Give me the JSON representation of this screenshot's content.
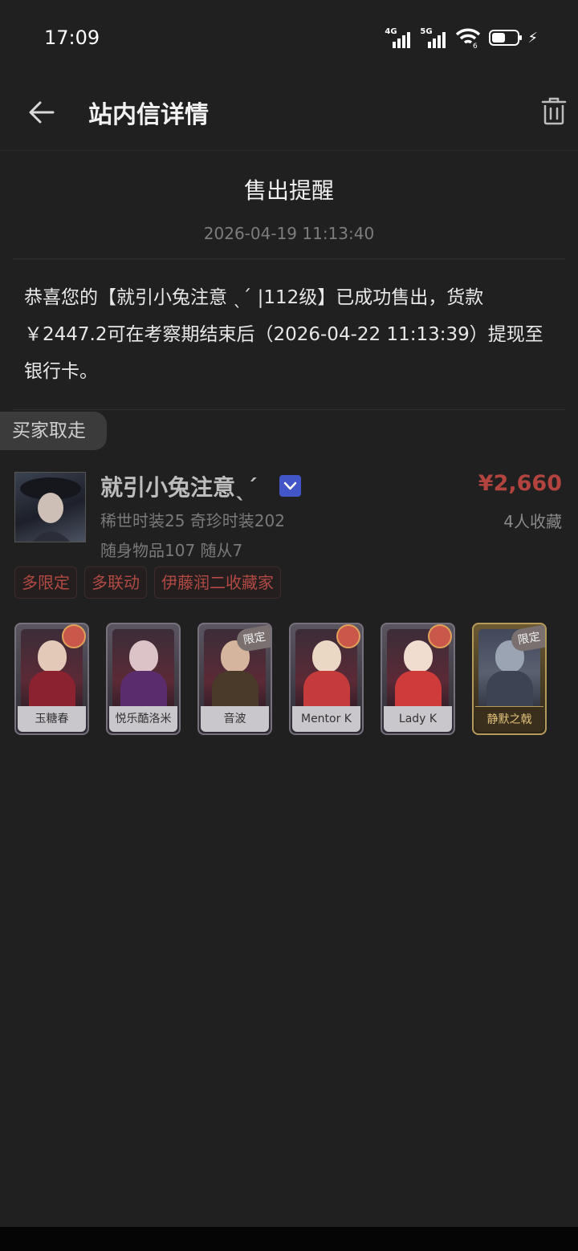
{
  "status_bar": {
    "time": "17:09",
    "signal1_tag": "4G",
    "signal2_tag": "5G",
    "wifi_badge": "6",
    "icons": [
      "signal-4g-icon",
      "signal-5g-icon",
      "wifi-icon",
      "battery-icon",
      "charging-icon"
    ]
  },
  "nav": {
    "title": "站内信详情",
    "back_icon": "back-arrow-icon",
    "delete_icon": "trash-icon"
  },
  "message": {
    "title": "售出提醒",
    "time": "2026-04-19 11:13:40",
    "body": "恭喜您的【就引小兔注意 ˎˊ |112级】已成功售出，货款￥2447.2可在考察期结束后（2026-04-22 11:13:39）提现至银行卡。"
  },
  "buyer_badge": "买家取走",
  "account": {
    "name": "就引小兔注意ˎˊ",
    "price": "¥2,660",
    "favorites": "4人收藏",
    "stats_line1": "稀世时装25 奇珍时装202",
    "stats_line2": "随身物品107 随从7",
    "verify_icon": "verified-chevron-icon"
  },
  "tags": [
    "多限定",
    "多联动",
    "伊藤润二收藏家"
  ],
  "cards": [
    {
      "name": "玉糖春",
      "badge": "",
      "gold": false
    },
    {
      "name": "悦乐酷洛米",
      "badge": "",
      "gold": false
    },
    {
      "name": "音波",
      "badge": "限定",
      "gold": false
    },
    {
      "name": "Mentor K",
      "badge": "",
      "gold": false
    },
    {
      "name": "Lady K",
      "badge": "",
      "gold": false
    },
    {
      "name": "静默之戟",
      "badge": "限定",
      "gold": true
    }
  ],
  "colors": {
    "background": "#202020",
    "price": "#b2433f",
    "tag_text": "#b24a44",
    "verify": "#4356c8"
  }
}
